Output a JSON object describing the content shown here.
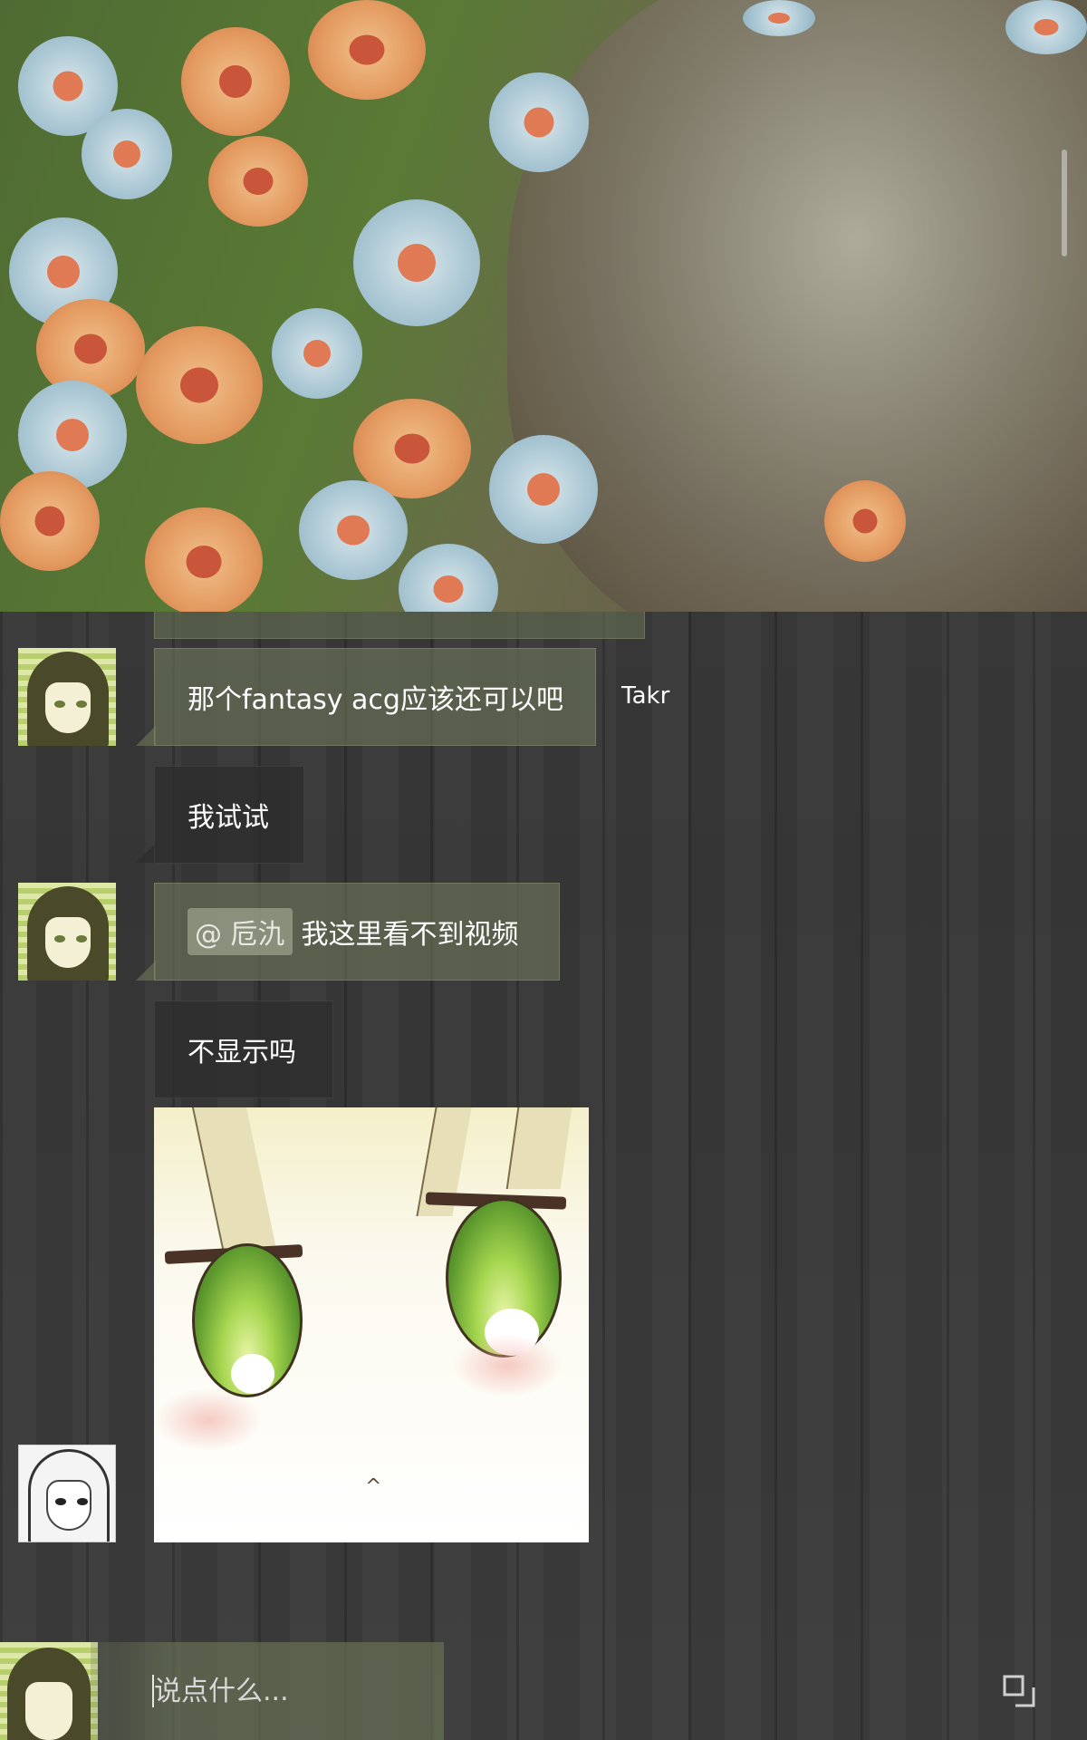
{
  "chat": {
    "messages": [
      {
        "text": "那个fantasy acg应该还可以吧",
        "sender": "Takr"
      },
      {
        "text": "我试试"
      },
      {
        "mention": "@ 卮氿",
        "text": "我这里看不到视频"
      },
      {
        "text": "不显示吗"
      }
    ]
  },
  "input": {
    "placeholder": "说点什么..."
  },
  "icons": {
    "expand": "expand-window-icon"
  },
  "colors": {
    "bubble_green": "#6e7858",
    "bubble_dark": "#2d2d2d",
    "background": "#3a3a3a"
  }
}
